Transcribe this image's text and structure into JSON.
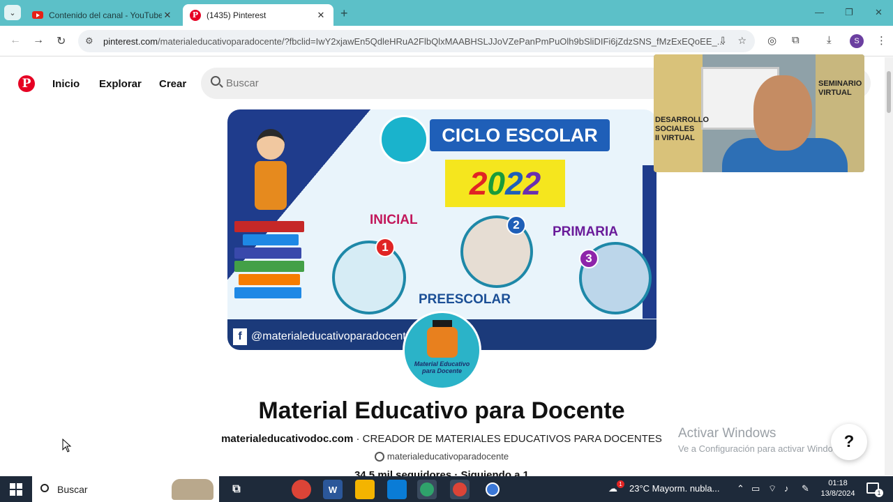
{
  "browser": {
    "tabs": [
      {
        "title": "Contenido del canal - YouTube",
        "favicon": "youtube-icon"
      },
      {
        "title": "(1435) Pinterest",
        "favicon": "pinterest-icon"
      }
    ],
    "url_host": "pinterest.com",
    "url_path": "/materialeducativoparadocente/?fbclid=IwY2xjawEn5QdleHRuA2FlbQlxMAABHSLJJoVZePanPmPuOlh9bSliDIFi6jZdzSNS_fMzExEQoEE_...",
    "profile_initial": "S"
  },
  "pinterest": {
    "nav": {
      "home": "Inicio",
      "explore": "Explorar",
      "create": "Crear"
    },
    "search_placeholder": "Buscar",
    "banner": {
      "title": "CICLO ESCOLAR",
      "year_digits": [
        "2",
        "0",
        "2",
        "2"
      ],
      "levels": {
        "inicial": "INICIAL",
        "preescolar": "PREESCOLAR",
        "primaria": "PRIMARIA"
      },
      "badges": [
        "1",
        "2",
        "3"
      ],
      "handle": "@materialeducativoparadocente",
      "fb_glyph": "f"
    },
    "avatar": {
      "line1": "Material Educativo",
      "line2": "para Docente"
    },
    "profile": {
      "name": "Material Educativo para Docente",
      "website": "materialeducativodoc.com",
      "separator": " · ",
      "description": "CREADOR DE MATERIALES EDUCATIVOS PARA DOCENTES",
      "username": "materialeducativoparadocente",
      "stats": "34,5 mil seguidores · Siguiendo a 1"
    },
    "help_label": "?"
  },
  "webcam": {
    "text_left": "DESARROLLO SOCIALES II VIRTUAL",
    "text_right": "SEMINARIO VIRTUAL"
  },
  "watermark": {
    "title": "Activar Windows",
    "subtitle": "Ve a Configuración para activar Windows."
  },
  "taskbar": {
    "search_label": "Buscar",
    "weather_badge": "1",
    "weather": "23°C  Mayorm. nubla...",
    "time": "01:18",
    "date": "13/8/2024",
    "notifications": "1"
  },
  "colors": {
    "pinterest_red": "#e60023",
    "browser_frame": "#5cc0c8",
    "banner_blue": "#1f5fb8"
  }
}
